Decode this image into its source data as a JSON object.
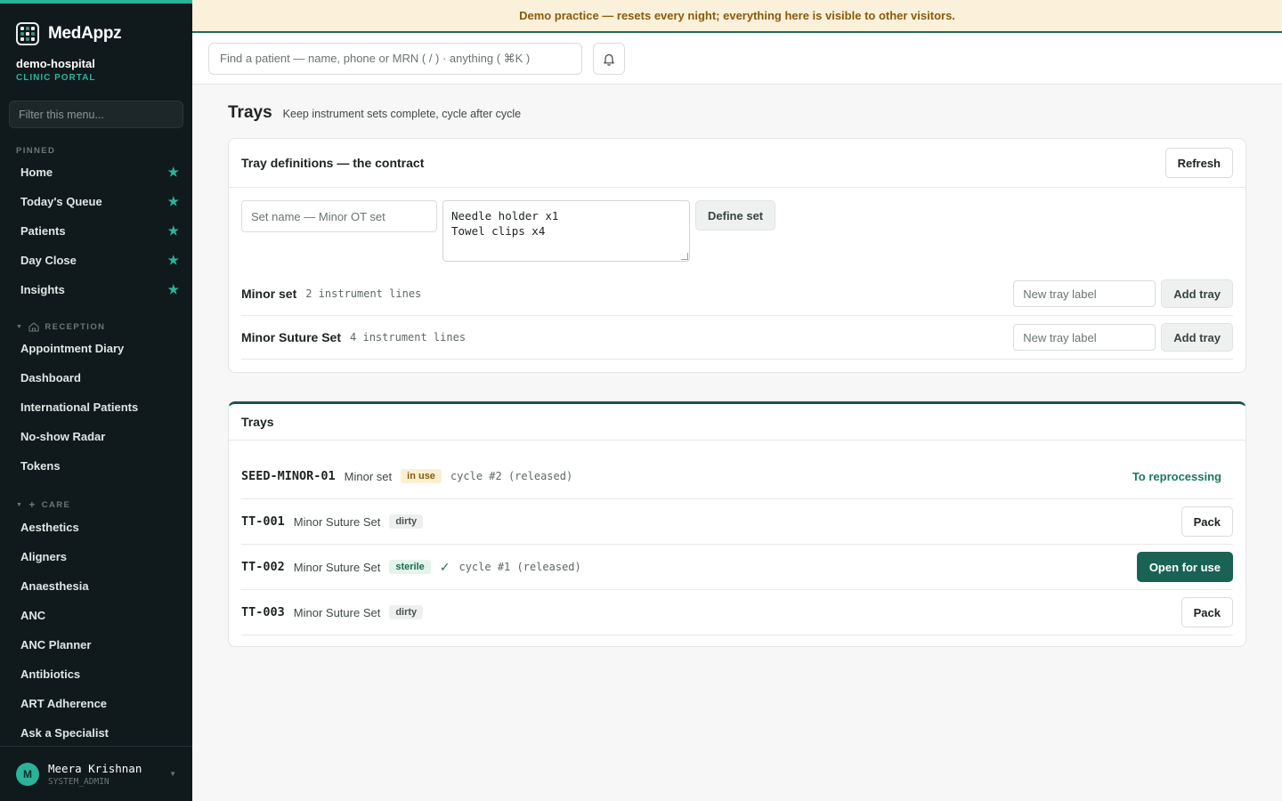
{
  "brand": {
    "name": "MedAppz"
  },
  "org": {
    "name": "demo-hospital",
    "subtitle": "CLINIC PORTAL"
  },
  "sidebar": {
    "filter_placeholder": "Filter this menu...",
    "pinned_title": "PINNED",
    "pinned": [
      {
        "label": "Home"
      },
      {
        "label": "Today's Queue"
      },
      {
        "label": "Patients"
      },
      {
        "label": "Day Close"
      },
      {
        "label": "Insights"
      }
    ],
    "reception_title": "RECEPTION",
    "reception": [
      {
        "label": "Appointment Diary"
      },
      {
        "label": "Dashboard"
      },
      {
        "label": "International Patients"
      },
      {
        "label": "No-show Radar"
      },
      {
        "label": "Tokens"
      }
    ],
    "care_title": "CARE",
    "care": [
      {
        "label": "Aesthetics"
      },
      {
        "label": "Aligners"
      },
      {
        "label": "Anaesthesia"
      },
      {
        "label": "ANC"
      },
      {
        "label": "ANC Planner"
      },
      {
        "label": "Antibiotics"
      },
      {
        "label": "ART Adherence"
      },
      {
        "label": "Ask a Specialist"
      }
    ]
  },
  "user": {
    "initial": "M",
    "name": "Meera Krishnan",
    "role": "SYSTEM_ADMIN"
  },
  "banner": {
    "text": "Demo practice — resets every night; everything here is visible to other visitors."
  },
  "topbar": {
    "search_placeholder": "Find a patient — name, phone or MRN ( / ) · anything ( ⌘K )"
  },
  "page": {
    "title": "Trays",
    "subtitle": "Keep instrument sets complete, cycle after cycle"
  },
  "definitions": {
    "title": "Tray definitions — the contract",
    "refresh_label": "Refresh",
    "set_name_placeholder": "Set name — Minor OT set",
    "instruments_text": "Needle holder x1\nTowel clips x4",
    "define_label": "Define set",
    "sets": [
      {
        "name": "Minor set",
        "lines": "2 instrument lines",
        "label_placeholder": "New tray label",
        "add_label": "Add tray"
      },
      {
        "name": "Minor Suture Set",
        "lines": "4 instrument lines",
        "label_placeholder": "New tray label",
        "add_label": "Add tray"
      }
    ]
  },
  "trays": {
    "title": "Trays",
    "rows": [
      {
        "id": "SEED-MINOR-01",
        "set": "Minor set",
        "status": "in use",
        "cycle": "cycle #2 (released)",
        "action": "To reprocessing"
      },
      {
        "id": "TT-001",
        "set": "Minor Suture Set",
        "status": "dirty",
        "cycle": "",
        "action": "Pack"
      },
      {
        "id": "TT-002",
        "set": "Minor Suture Set",
        "status": "sterile",
        "cycle": "cycle #1 (released)",
        "action": "Open for use"
      },
      {
        "id": "TT-003",
        "set": "Minor Suture Set",
        "status": "dirty",
        "cycle": "",
        "action": "Pack"
      }
    ]
  },
  "colors": {
    "accent": "#2bb39a",
    "primary": "#1a6354",
    "sidebar_bg": "#10191c",
    "banner_bg": "#fbf0d9"
  }
}
